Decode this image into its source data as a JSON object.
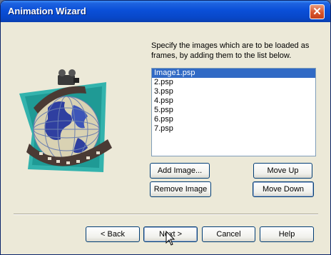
{
  "window": {
    "title": "Animation Wizard",
    "close_label": "✕"
  },
  "instructions": "Specify the images which are to be loaded as frames, by adding them to the list below.",
  "frames": [
    "Image1.psp",
    "2.psp",
    "3.psp",
    "4.psp",
    "5.psp",
    "6.psp",
    "7.psp"
  ],
  "selected_frame": "Image1.psp",
  "buttons": {
    "add_image": "Add Image...",
    "remove_image": "Remove Image",
    "move_up": "Move Up",
    "move_down": "Move Down",
    "back": "< Back",
    "next": "Next >",
    "cancel": "Cancel",
    "help": "Help"
  },
  "colors": {
    "title_bar": "#0a4fd8",
    "selection": "#316ac5",
    "dialog_bg": "#ece9d8"
  },
  "icons": {
    "wizard_image": "globe-film-icon",
    "close": "close-icon",
    "pointer": "mouse-cursor-icon"
  }
}
